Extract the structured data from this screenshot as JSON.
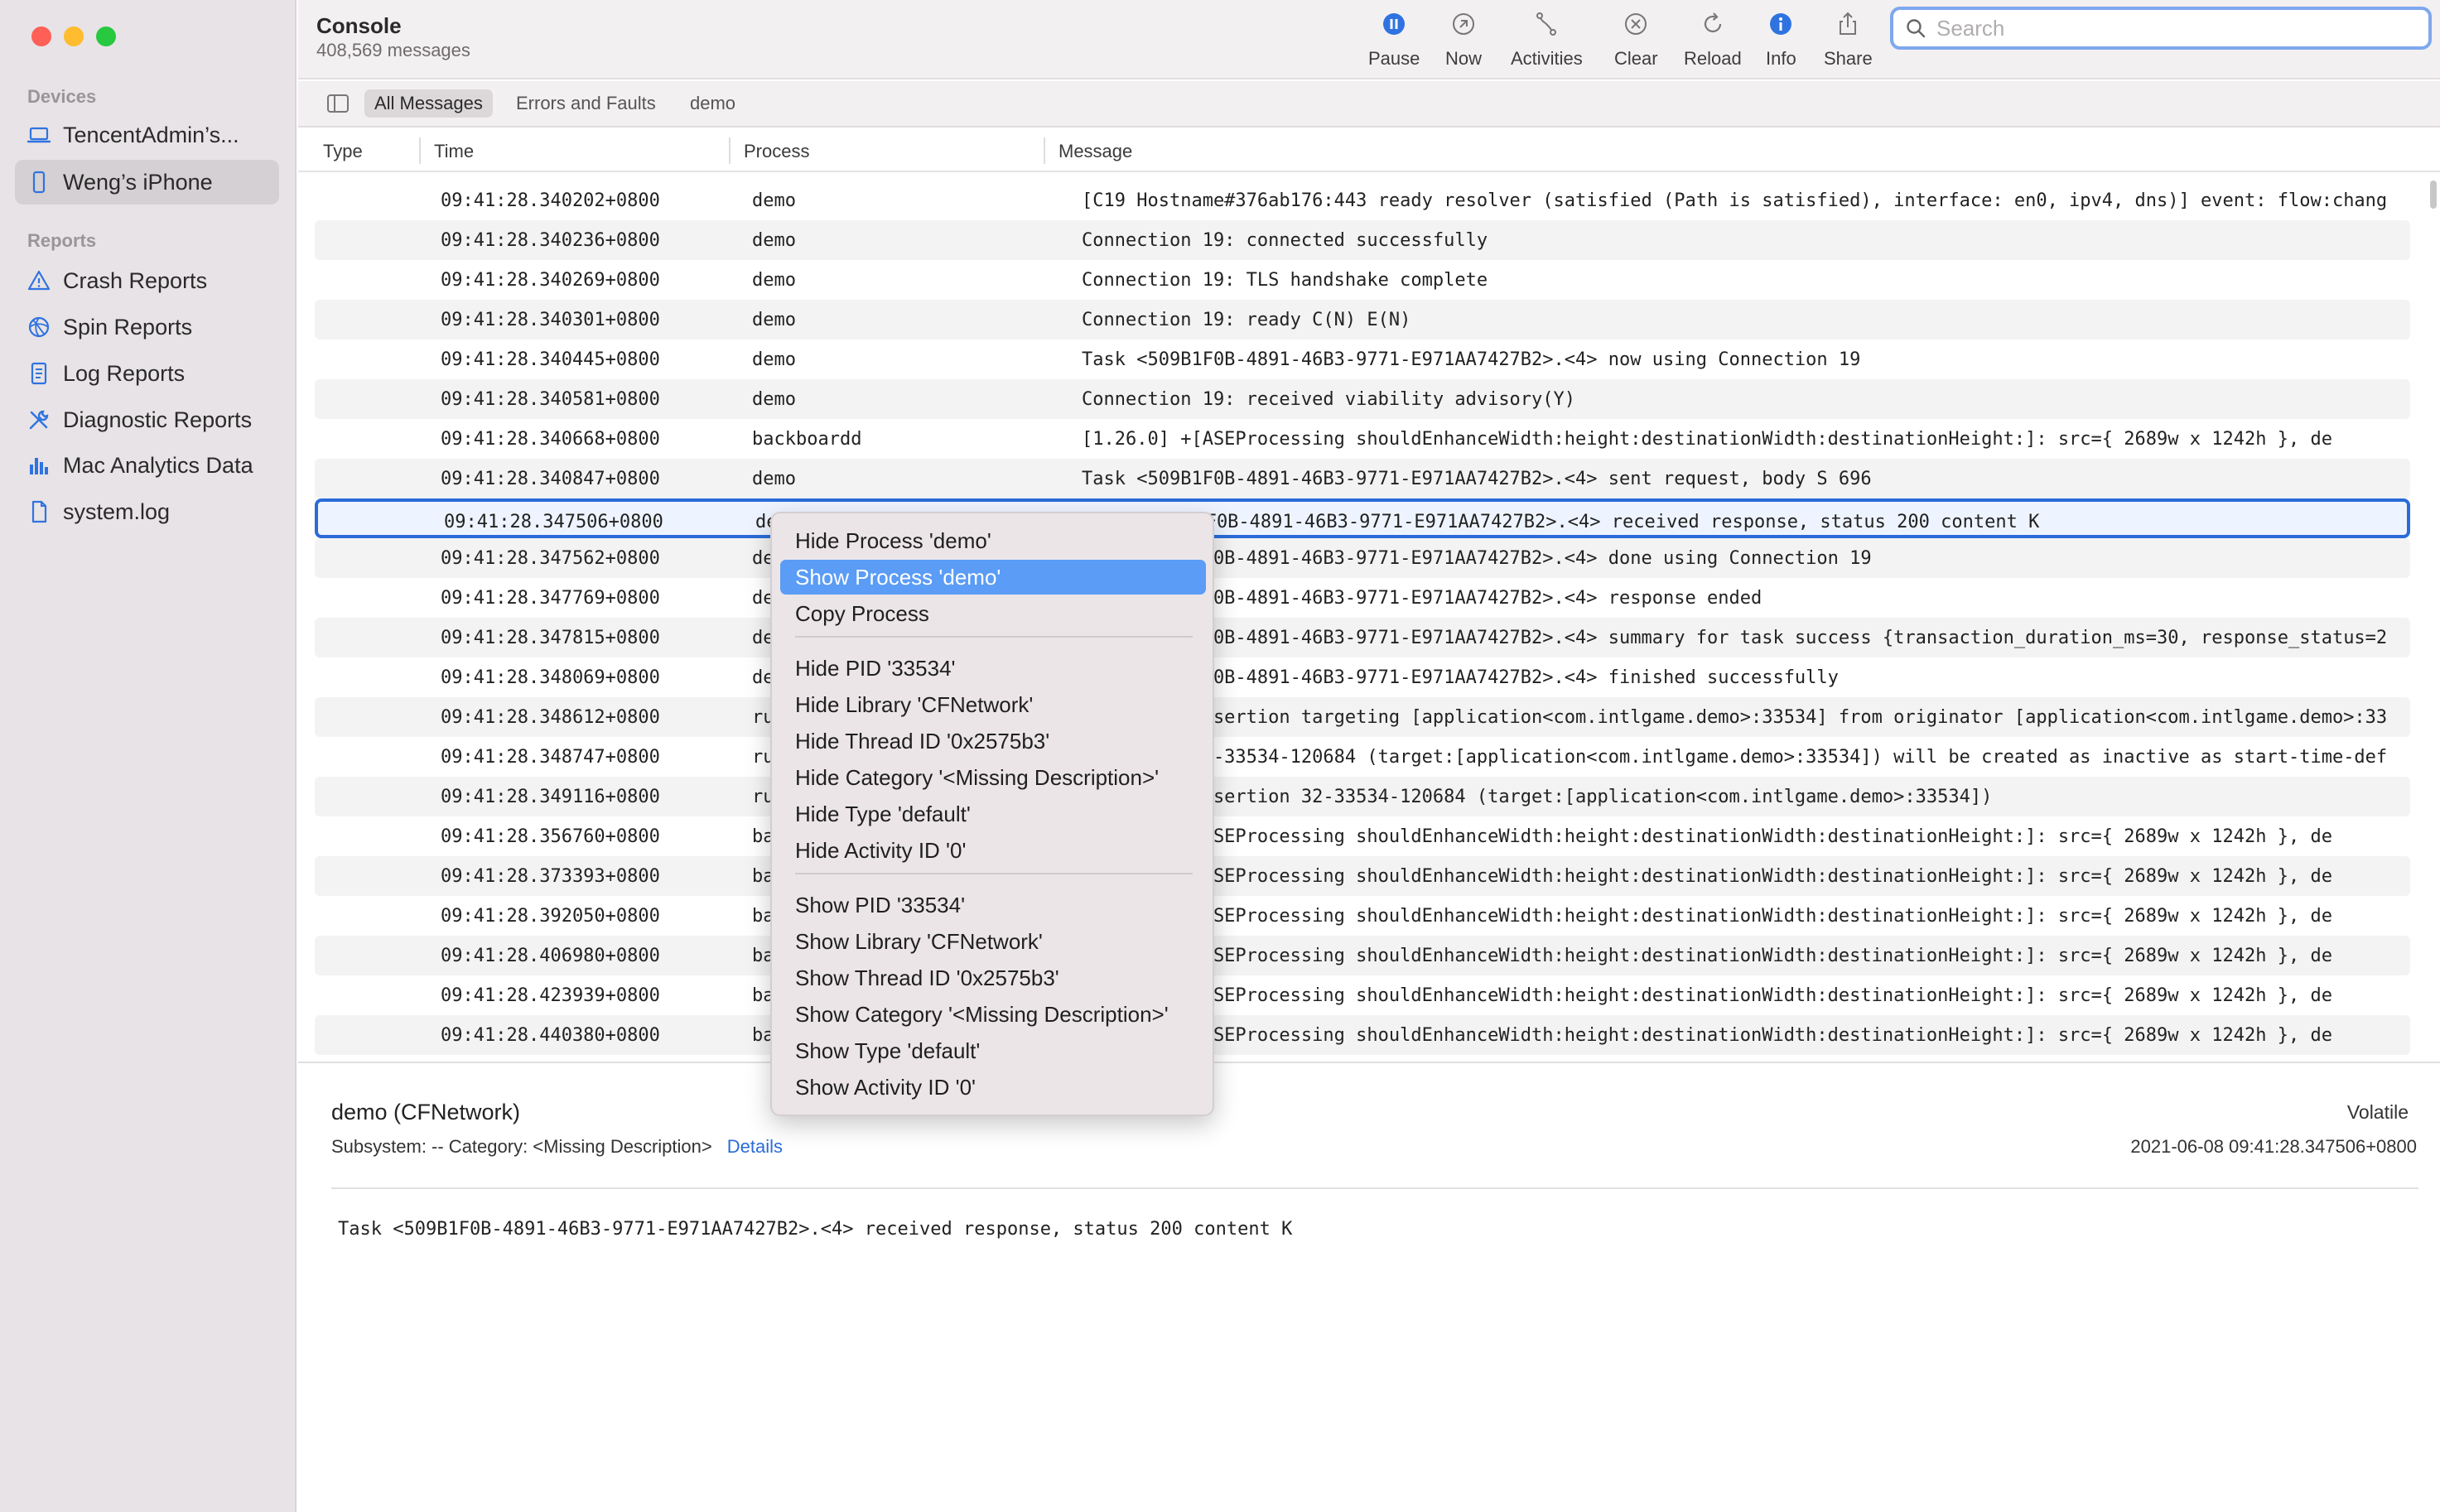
{
  "window": {
    "title": "Console",
    "subtitle": "408,569 messages"
  },
  "sidebar": {
    "devices_header": "Devices",
    "devices": [
      {
        "label": "TencentAdmin’s...",
        "icon": "laptop-icon"
      },
      {
        "label": "Weng’s iPhone",
        "icon": "iphone-icon",
        "selected": true
      }
    ],
    "reports_header": "Reports",
    "reports": [
      {
        "label": "Crash Reports",
        "icon": "warning-icon"
      },
      {
        "label": "Spin Reports",
        "icon": "spin-icon"
      },
      {
        "label": "Log Reports",
        "icon": "document-icon"
      },
      {
        "label": "Diagnostic Reports",
        "icon": "tools-icon"
      },
      {
        "label": "Mac Analytics Data",
        "icon": "bar-chart-icon"
      },
      {
        "label": "system.log",
        "icon": "file-icon"
      }
    ]
  },
  "toolbar": {
    "pause": "Pause",
    "now": "Now",
    "activities": "Activities",
    "clear": "Clear",
    "reload": "Reload",
    "info": "Info",
    "share": "Share",
    "search_placeholder": "Search",
    "accent": "#2f73e0"
  },
  "filters": {
    "all": "All Messages",
    "errors": "Errors and Faults",
    "demo": "demo"
  },
  "columns": {
    "type": "Type",
    "time": "Time",
    "process": "Process",
    "message": "Message"
  },
  "rows": [
    {
      "time": "09:41:28.340202+0800",
      "process": "demo",
      "message": "[C19 Hostname#376ab176:443 ready resolver (satisfied (Path is satisfied), interface: en0, ipv4, dns)] event: flow:chang"
    },
    {
      "time": "09:41:28.340236+0800",
      "process": "demo",
      "message": "Connection 19: connected successfully"
    },
    {
      "time": "09:41:28.340269+0800",
      "process": "demo",
      "message": "Connection 19: TLS handshake complete"
    },
    {
      "time": "09:41:28.340301+0800",
      "process": "demo",
      "message": "Connection 19: ready C(N) E(N)"
    },
    {
      "time": "09:41:28.340445+0800",
      "process": "demo",
      "message": "Task <509B1F0B-4891-46B3-9771-E971AA7427B2>.<4> now using Connection 19"
    },
    {
      "time": "09:41:28.340581+0800",
      "process": "demo",
      "message": "Connection 19: received viability advisory(Y)"
    },
    {
      "time": "09:41:28.340668+0800",
      "process": "backboardd",
      "message": " [1.26.0]     +[ASEProcessing shouldEnhanceWidth:height:destinationWidth:destinationHeight:]: src={ 2689w x 1242h }, de"
    },
    {
      "time": "09:41:28.340847+0800",
      "process": "demo",
      "message": "Task <509B1F0B-4891-46B3-9771-E971AA7427B2>.<4> sent request, body S 696"
    },
    {
      "time": "09:41:28.347506+0800",
      "process": "demo",
      "message": "Task <509B1F0B-4891-46B3-9771-E971AA7427B2>.<4> received response, status 200 content K",
      "selected": true
    },
    {
      "time": "09:41:28.347562+0800",
      "process": "demo",
      "message": "Task <509B1F0B-4891-46B3-9771-E971AA7427B2>.<4> done using Connection 19"
    },
    {
      "time": "09:41:28.347769+0800",
      "process": "demo",
      "message": "Task <509B1F0B-4891-46B3-9771-E971AA7427B2>.<4> response ended"
    },
    {
      "time": "09:41:28.347815+0800",
      "process": "demo",
      "message": "Task <509B1F0B-4891-46B3-9771-E971AA7427B2>.<4> summary for task success {transaction_duration_ms=30, response_status=2"
    },
    {
      "time": "09:41:28.348069+0800",
      "process": "demo",
      "message": "Task <509B1F0B-4891-46B3-9771-E971AA7427B2>.<4> finished successfully"
    },
    {
      "time": "09:41:28.348612+0800",
      "process": "runningboardd",
      "message": "Acquiring assertion targeting [application<com.intlgame.demo>:33534] from originator [application<com.intlgame.demo>:33"
    },
    {
      "time": "09:41:28.348747+0800",
      "process": "runningboardd",
      "message": "Assertion 32-33534-120684 (target:[application<com.intlgame.demo>:33534]) will be created as inactive as start-time-def"
    },
    {
      "time": "09:41:28.349116+0800",
      "process": "runningboardd",
      "message": "Acquiring assertion 32-33534-120684 (target:[application<com.intlgame.demo>:33534])"
    },
    {
      "time": "09:41:28.356760+0800",
      "process": "backboardd",
      "message": " [1.26.0]     +[ASEProcessing shouldEnhanceWidth:height:destinationWidth:destinationHeight:]: src={ 2689w x 1242h }, de"
    },
    {
      "time": "09:41:28.373393+0800",
      "process": "backboardd",
      "message": " [1.26.0]     +[ASEProcessing shouldEnhanceWidth:height:destinationWidth:destinationHeight:]: src={ 2689w x 1242h }, de"
    },
    {
      "time": "09:41:28.392050+0800",
      "process": "backboardd",
      "message": " [1.26.0]     +[ASEProcessing shouldEnhanceWidth:height:destinationWidth:destinationHeight:]: src={ 2689w x 1242h }, de"
    },
    {
      "time": "09:41:28.406980+0800",
      "process": "backboardd",
      "message": " [1.26.0]     +[ASEProcessing shouldEnhanceWidth:height:destinationWidth:destinationHeight:]: src={ 2689w x 1242h }, de"
    },
    {
      "time": "09:41:28.423939+0800",
      "process": "backboardd",
      "message": " [1.26.0]     +[ASEProcessing shouldEnhanceWidth:height:destinationWidth:destinationHeight:]: src={ 2689w x 1242h }, de"
    },
    {
      "time": "09:41:28.440380+0800",
      "process": "backboardd",
      "message": " [1.26.0]     +[ASEProcessing shouldEnhanceWidth:height:destinationWidth:destinationHeight:]: src={ 2689w x 1242h }, de"
    }
  ],
  "context_menu": {
    "items": [
      "Hide Process 'demo'",
      "Show Process 'demo'",
      "Copy Process",
      "Hide PID '33534'",
      "Hide Library 'CFNetwork'",
      "Hide Thread ID '0x2575b3'",
      "Hide Category '<Missing Description>'",
      "Hide Type 'default'",
      "Hide Activity ID '0'",
      "Show PID '33534'",
      "Show Library 'CFNetwork'",
      "Show Thread ID '0x2575b3'",
      "Show Category '<Missing Description>'",
      "Show Type 'default'",
      "Show Activity ID '0'"
    ],
    "highlighted_index": 1
  },
  "detail": {
    "title": "demo (CFNetwork)",
    "volatile": "Volatile",
    "subsystem": "Subsystem: --   Category: <Missing Description>",
    "details_link": "Details",
    "timestamp": "2021-06-08 09:41:28.347506+0800",
    "message": "Task <509B1F0B-4891-46B3-9771-E971AA7427B2>.<4> received response, status 200 content K"
  }
}
